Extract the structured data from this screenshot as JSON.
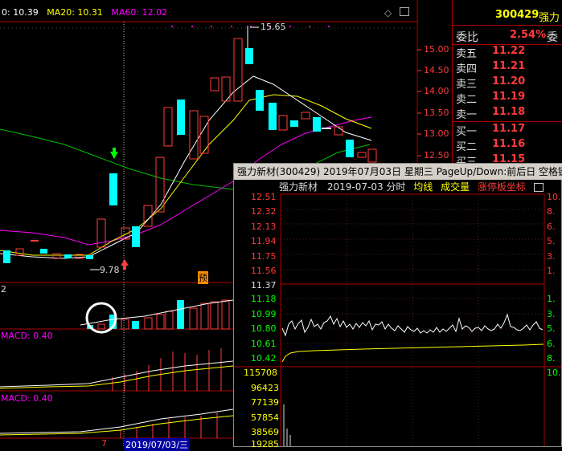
{
  "ma_legend": {
    "ma5": "0: 10.39",
    "ma20": "MA20: 10.31",
    "ma60": "MA60: 12.02"
  },
  "price_axis": [
    "15.00",
    "14.50",
    "14.00",
    "13.50",
    "13.00",
    "12.50"
  ],
  "high_label": "15.65",
  "low_label": "9.78",
  "yu_label": "预",
  "vol_label": "2",
  "macd1_label": "MACD: 0.40",
  "macd2_label": "MACD: 0.40",
  "bottom_date": "2019/07/03/三",
  "bottom_left": "7",
  "right_panel": {
    "code": "300429",
    "name": "强力",
    "wei_bi_label": "委比",
    "wei_bi_value": "2.54%",
    "wei_cha_label": "委",
    "orders": [
      {
        "label": "卖五",
        "price": "11.22"
      },
      {
        "label": "卖四",
        "price": "11.21"
      },
      {
        "label": "卖三",
        "price": "11.20"
      },
      {
        "label": "卖二",
        "price": "11.19"
      },
      {
        "label": "卖一",
        "price": "11.18"
      },
      {
        "label": "买一",
        "price": "11.17"
      },
      {
        "label": "买二",
        "price": "11.16"
      },
      {
        "label": "买三",
        "price": "11.15"
      }
    ]
  },
  "popup": {
    "title": "强力新材(300429) 2019年07月03日 星期三 PageUp/Down:前后日 空格键",
    "sub_name": "强力新材",
    "sub_date": "2019-07-03 分时",
    "sub_avg": "均线",
    "sub_vol": "成交量",
    "sub_limit": "涨停板坐标",
    "price_ticks": [
      "12.51",
      "12.32",
      "12.13",
      "11.94",
      "11.75",
      "11.56",
      "11.37",
      "11.18",
      "10.99",
      "10.80",
      "10.61",
      "10.42"
    ],
    "vol_ticks": [
      "115708",
      "96423",
      "77139",
      "57854",
      "38569",
      "19285"
    ],
    "right_ticks": [
      "10.",
      "8.",
      "6.",
      "5.",
      "3.",
      "1.",
      "1.",
      "3.",
      "5.",
      "6.",
      "8.",
      "10."
    ],
    "colors": {
      "price_line": "#ffffff",
      "avg_line": "#ffff00",
      "up": "#ff3b3b",
      "down": "#00ff00"
    }
  },
  "icons": {
    "diamond": "diamond-icon",
    "restore": "restore-icon",
    "popup_close": "close-icon"
  }
}
